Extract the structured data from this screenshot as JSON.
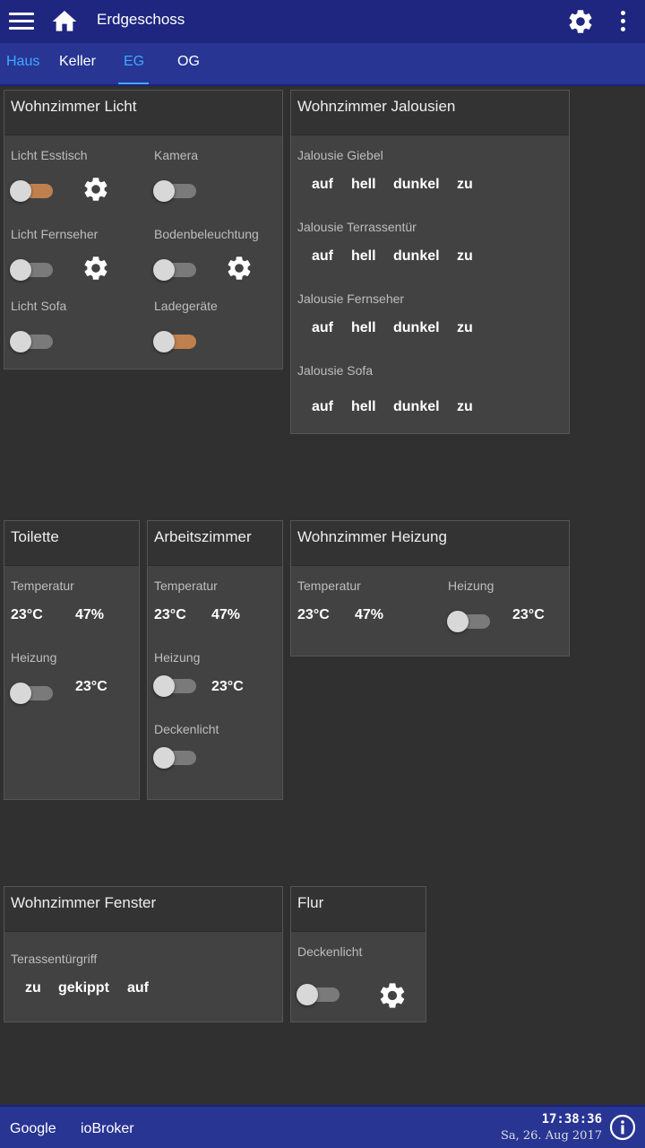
{
  "header": {
    "title": "Erdgeschoss",
    "icons": [
      "menu-icon",
      "home-icon",
      "gear-icon",
      "more-vert-icon"
    ]
  },
  "tabs": [
    {
      "label": "Haus",
      "style": "link"
    },
    {
      "label": "Keller",
      "style": "normal"
    },
    {
      "label": "EG",
      "style": "active"
    },
    {
      "label": "OG",
      "style": "normal"
    }
  ],
  "cards": {
    "licht": {
      "title": "Wohnzimmer Licht",
      "esstisch": {
        "label": "Licht Esstisch",
        "state": "on"
      },
      "kamera": {
        "label": "Kamera",
        "state": "off"
      },
      "fernseher": {
        "label": "Licht Fernseher",
        "state": "off"
      },
      "boden": {
        "label": "Bodenbeleuchtung",
        "state": "off"
      },
      "sofa": {
        "label": "Licht Sofa",
        "state": "off"
      },
      "lade": {
        "label": "Ladegeräte",
        "state": "on"
      }
    },
    "jalousien": {
      "title": "Wohnzimmer Jalousien",
      "buttons": [
        "auf",
        "hell",
        "dunkel",
        "zu"
      ],
      "groups": [
        {
          "label": "Jalousie Giebel"
        },
        {
          "label": "Jalousie Terrassentür"
        },
        {
          "label": "Jalousie Fernseher"
        },
        {
          "label": "Jalousie Sofa"
        }
      ]
    },
    "toilette": {
      "title": "Toilette",
      "temp_label": "Temperatur",
      "temp": "23°C",
      "hum": "47%",
      "heiz_label": "Heizung",
      "heiz_state": "off",
      "heiz_val": "23°C"
    },
    "arbeit": {
      "title": "Arbeitszimmer",
      "temp_label": "Temperatur",
      "temp": "23°C",
      "hum": "47%",
      "heiz_label": "Heizung",
      "heiz_state": "off",
      "heiz_val": "23°C",
      "licht_label": "Deckenlicht",
      "licht_state": "off"
    },
    "heizung": {
      "title": "Wohnzimmer Heizung",
      "temp_label": "Temperatur",
      "temp": "23°C",
      "hum": "47%",
      "heiz_label": "Heizung",
      "heiz_state": "off",
      "heiz_val": "23°C"
    },
    "fenster": {
      "title": "Wohnzimmer Fenster",
      "label": "Terassentürgriff",
      "buttons": [
        "zu",
        "gekippt",
        "auf"
      ]
    },
    "flur": {
      "title": "Flur",
      "label": "Deckenlicht",
      "state": "off"
    }
  },
  "footer": {
    "links": [
      "Google",
      "ioBroker"
    ],
    "time": "17:38:36",
    "date": "Sa, 26. Aug 2017",
    "icon": "info-icon"
  },
  "colors": {
    "header": "#1f2680",
    "tabbar": "#283593",
    "accent": "#40a9ff",
    "toggle_on": "#c0804e",
    "background": "#303030",
    "card": "#424242"
  }
}
